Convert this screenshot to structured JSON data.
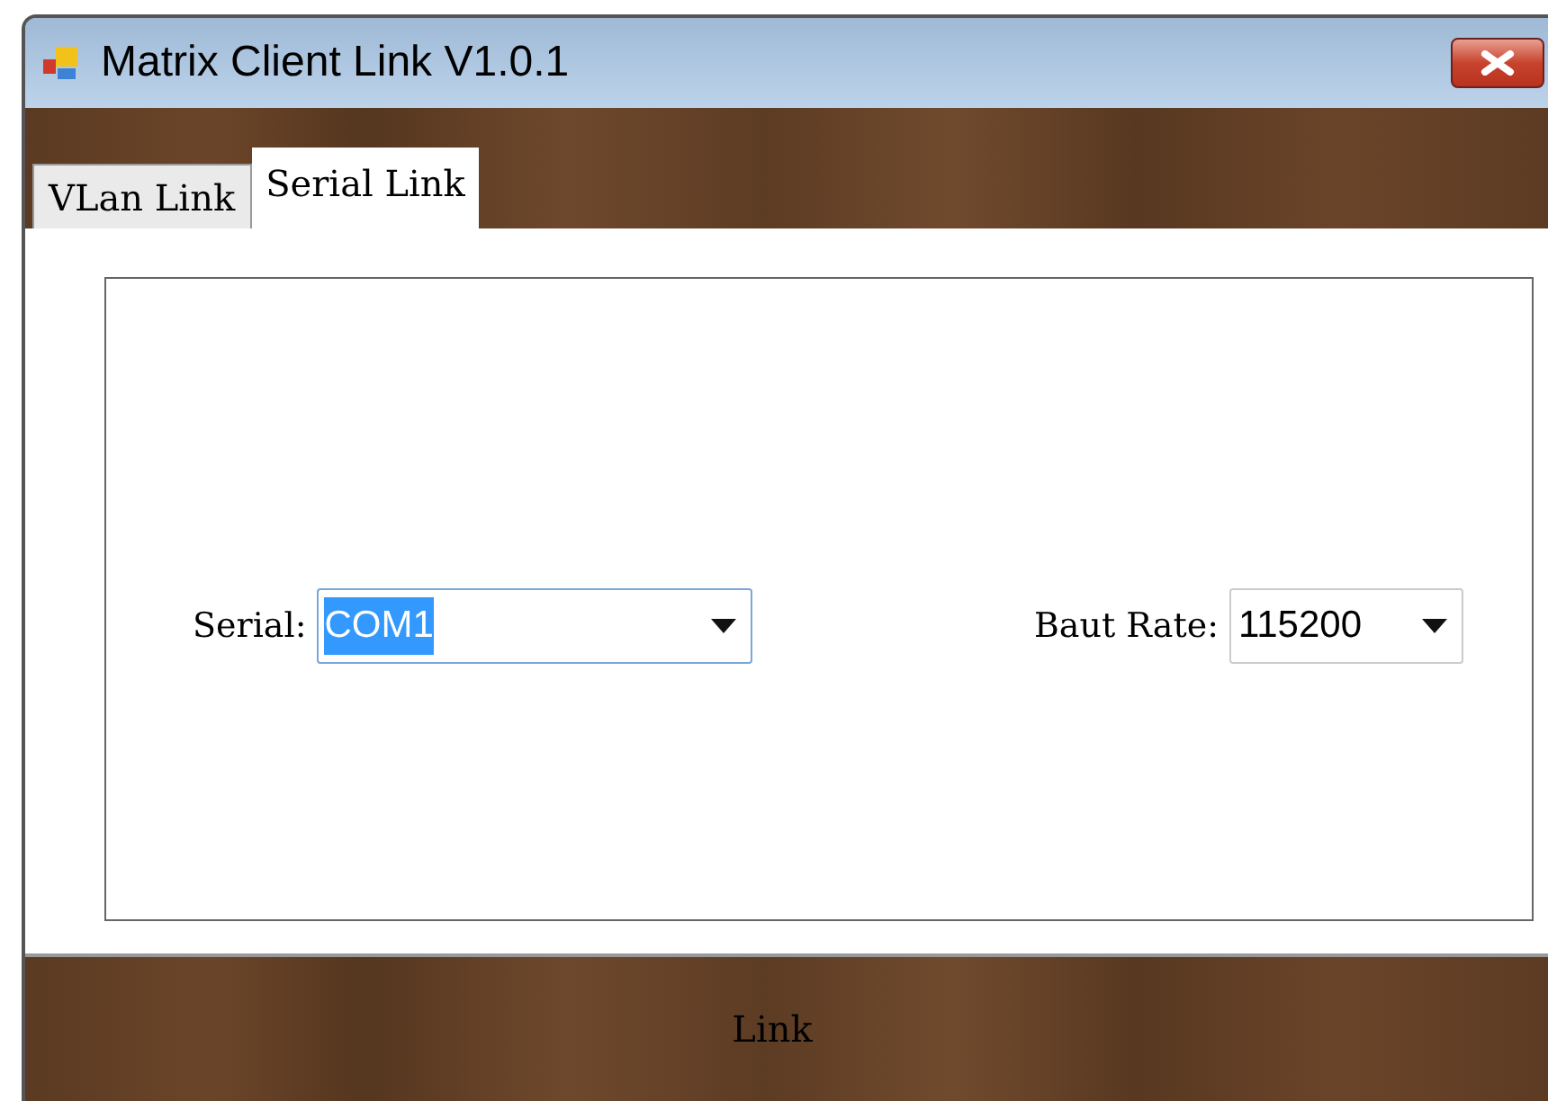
{
  "window": {
    "title": "Matrix Client Link V1.0.1"
  },
  "tabs": [
    {
      "label": "VLan Link",
      "selected": false
    },
    {
      "label": "Serial Link",
      "selected": true
    }
  ],
  "serial": {
    "label": "Serial:",
    "value": "COM1",
    "text_selected": true
  },
  "baud_rate": {
    "label": "Baut Rate:",
    "value": "115200"
  },
  "link_button": {
    "label": "Link"
  }
}
